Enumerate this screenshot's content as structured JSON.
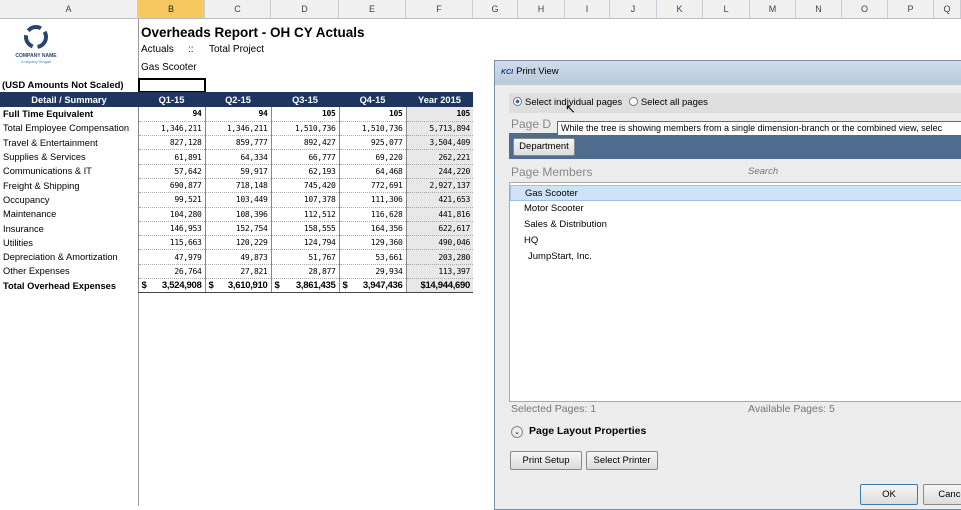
{
  "columns": [
    "A",
    "B",
    "C",
    "D",
    "E",
    "F",
    "G",
    "H",
    "I",
    "J",
    "K",
    "L",
    "M",
    "N",
    "O",
    "P",
    "Q"
  ],
  "logo": {
    "name": "COMPANY NAME",
    "slogan": "Company Slogan"
  },
  "report": {
    "title": "Overheads Report - OH CY Actuals",
    "scenario": "Actuals",
    "sep": "::",
    "project": "Total Project",
    "entity": "Gas Scooter",
    "scale_note": "(USD Amounts Not Scaled)"
  },
  "table": {
    "headers": [
      "Detail / Summary",
      "Q1-15",
      "Q2-15",
      "Q3-15",
      "Q4-15",
      "Year 2015"
    ],
    "rows": [
      {
        "label": "Full Time Equivalent",
        "values": [
          "94",
          "94",
          "105",
          "105",
          "105"
        ],
        "bold": true
      },
      {
        "label": "Total Employee Compensation",
        "values": [
          "1,346,211",
          "1,346,211",
          "1,510,736",
          "1,510,736",
          "5,713,894"
        ]
      },
      {
        "label": "Travel & Entertainment",
        "values": [
          "827,128",
          "859,777",
          "892,427",
          "925,077",
          "3,504,409"
        ]
      },
      {
        "label": "Supplies & Services",
        "values": [
          "61,891",
          "64,334",
          "66,777",
          "69,220",
          "262,221"
        ]
      },
      {
        "label": "Communications & IT",
        "values": [
          "57,642",
          "59,917",
          "62,193",
          "64,468",
          "244,220"
        ]
      },
      {
        "label": "Freight & Shipping",
        "values": [
          "690,877",
          "718,148",
          "745,420",
          "772,691",
          "2,927,137"
        ]
      },
      {
        "label": "Occupancy",
        "values": [
          "99,521",
          "103,449",
          "107,378",
          "111,306",
          "421,653"
        ]
      },
      {
        "label": "Maintenance",
        "values": [
          "104,280",
          "108,396",
          "112,512",
          "116,628",
          "441,816"
        ]
      },
      {
        "label": "Insurance",
        "values": [
          "146,953",
          "152,754",
          "158,555",
          "164,356",
          "622,617"
        ]
      },
      {
        "label": "Utilities",
        "values": [
          "115,663",
          "120,229",
          "124,794",
          "129,360",
          "490,046"
        ]
      },
      {
        "label": "Depreciation & Amortization",
        "values": [
          "47,979",
          "49,873",
          "51,767",
          "53,661",
          "203,280"
        ]
      },
      {
        "label": "Other Expenses",
        "values": [
          "26,764",
          "27,821",
          "28,877",
          "29,934",
          "113,397"
        ]
      },
      {
        "label": "Total Overhead Expenses",
        "values": [
          "3,524,908",
          "3,610,910",
          "3,861,435",
          "3,947,436",
          "$14,944,690"
        ],
        "bold": true,
        "total": true,
        "currency": "$"
      }
    ]
  },
  "dialog": {
    "title": "Print View",
    "app_badge": "KCI",
    "radio_individual": "Select individual pages",
    "radio_all": "Select all pages",
    "page_dims_label": "Page D",
    "tooltip": "While the tree is showing members from a single dimension-branch or the combined view, selec",
    "dimension_button": "Department",
    "members_label": "Page Members",
    "search_placeholder": "Search",
    "members": [
      "Gas Scooter",
      "Motor Scooter",
      "Sales & Distribution",
      "HQ",
      "JumpStart, Inc."
    ],
    "selected_pages": "Selected Pages: 1",
    "available_pages": "Available Pages: 5",
    "layout_props": "Page Layout Properties",
    "print_setup": "Print Setup",
    "select_printer": "Select Printer",
    "ok": "OK",
    "cancel": "Cance"
  },
  "colors": {
    "header_bg": "#1e3560",
    "dialog_dim_bar": "#4f6b8e",
    "selected_member": "#cfe2f7"
  }
}
